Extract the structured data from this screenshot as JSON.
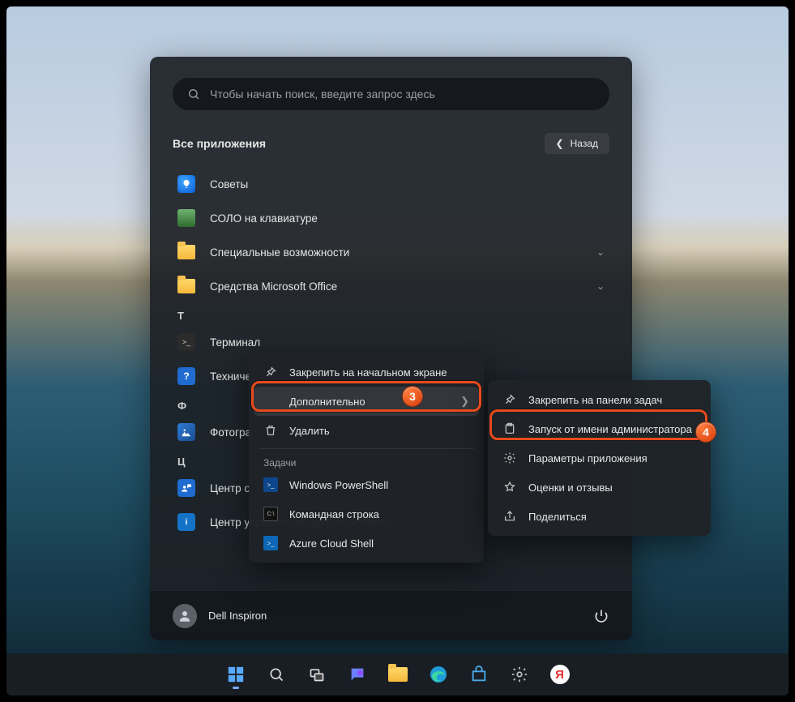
{
  "search": {
    "placeholder": "Чтобы начать поиск, введите запрос здесь"
  },
  "heading": "Все приложения",
  "back_label": "Назад",
  "letters": {
    "t": "Т",
    "f": "Ф",
    "c": "Ц"
  },
  "apps": {
    "tips": {
      "label": "Советы"
    },
    "solo": {
      "label": "СОЛО на клавиатуре"
    },
    "access": {
      "label": "Специальные возможности"
    },
    "office": {
      "label": "Средства Microsoft Office"
    },
    "terminal": {
      "label": "Терминал"
    },
    "support": {
      "label": "Техниче"
    },
    "photos": {
      "label": "Фотогра"
    },
    "feedback": {
      "label": "Центр о"
    },
    "intel": {
      "label": "Центр управления графикой Intel®"
    }
  },
  "user": {
    "name": "Dell Inspiron"
  },
  "ctx1": {
    "pin_start": "Закрепить на начальном экране",
    "more": "Дополнительно",
    "uninstall": "Удалить",
    "tasks_header": "Задачи",
    "task_ps": "Windows PowerShell",
    "task_cmd": "Командная строка",
    "task_azure": "Azure Cloud Shell"
  },
  "ctx2": {
    "pin_taskbar": "Закрепить на панели задач",
    "run_admin": "Запуск от имени администратора",
    "app_settings": "Параметры приложения",
    "reviews": "Оценки и отзывы",
    "share": "Поделиться"
  },
  "annot": {
    "n3": "3",
    "n4": "4"
  }
}
